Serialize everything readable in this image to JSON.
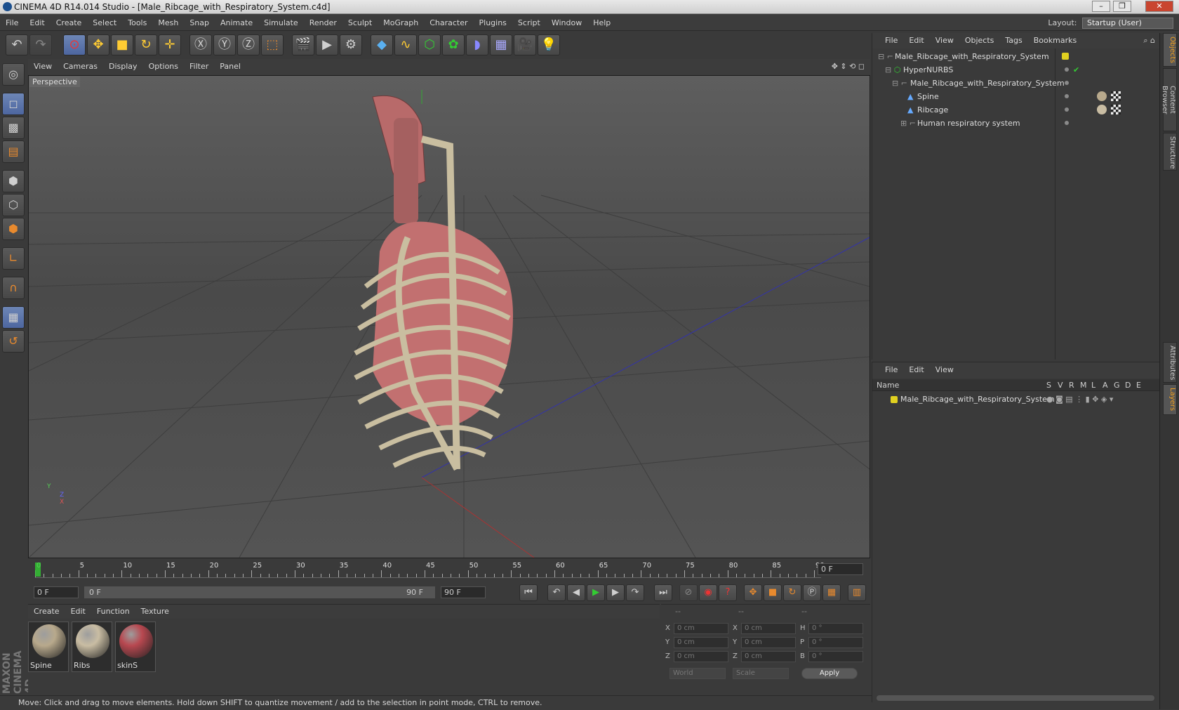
{
  "window": {
    "title": "CINEMA 4D R14.014 Studio - [Male_Ribcage_with_Respiratory_System.c4d]"
  },
  "menu": [
    "File",
    "Edit",
    "Create",
    "Select",
    "Tools",
    "Mesh",
    "Snap",
    "Animate",
    "Simulate",
    "Render",
    "Sculpt",
    "MoGraph",
    "Character",
    "Plugins",
    "Script",
    "Window",
    "Help"
  ],
  "layout": {
    "label": "Layout:",
    "value": "Startup (User)"
  },
  "viewport": {
    "menu": [
      "View",
      "Cameras",
      "Display",
      "Options",
      "Filter",
      "Panel"
    ],
    "label": "Perspective",
    "axis": {
      "x": "X",
      "y": "Y",
      "z": "Z"
    }
  },
  "timeline": {
    "ticks": [
      "0",
      "5",
      "10",
      "15",
      "20",
      "25",
      "30",
      "35",
      "40",
      "45",
      "50",
      "55",
      "60",
      "65",
      "70",
      "75",
      "80",
      "85",
      "90"
    ],
    "current_frame": "0 F",
    "start_field": "0 F",
    "range_start": "0 F",
    "range_end": "90 F",
    "end_field": "90 F"
  },
  "materials": {
    "menu": [
      "Create",
      "Edit",
      "Function",
      "Texture"
    ],
    "items": [
      {
        "name": "Spine",
        "color": "#b8a98c"
      },
      {
        "name": "Ribs",
        "color": "#c9bda3"
      },
      {
        "name": "skinS",
        "color": "#b84850"
      }
    ]
  },
  "coords": {
    "header": [
      "--",
      "--",
      "--"
    ],
    "rows": [
      {
        "a": "X",
        "av": "0 cm",
        "b": "X",
        "bv": "0 cm",
        "c": "H",
        "cv": "0 °"
      },
      {
        "a": "Y",
        "av": "0 cm",
        "b": "Y",
        "bv": "0 cm",
        "c": "P",
        "cv": "0 °"
      },
      {
        "a": "Z",
        "av": "0 cm",
        "b": "Z",
        "bv": "0 cm",
        "c": "B",
        "cv": "0 °"
      }
    ],
    "mode1": "World",
    "mode2": "Scale",
    "apply": "Apply"
  },
  "objects": {
    "menu": [
      "File",
      "Edit",
      "View",
      "Objects",
      "Tags",
      "Bookmarks"
    ],
    "tree": [
      {
        "name": "Male_Ribcage_with_Respiratory_System",
        "level": 0
      },
      {
        "name": "HyperNURBS",
        "level": 1
      },
      {
        "name": "Male_Ribcage_with_Respiratory_System",
        "level": 2
      },
      {
        "name": "Spine",
        "level": 3
      },
      {
        "name": "Ribcage",
        "level": 3
      },
      {
        "name": "Human respiratory system",
        "level": 3
      }
    ]
  },
  "layers": {
    "menu": [
      "File",
      "Edit",
      "View"
    ],
    "header": {
      "name": "Name",
      "cols": [
        "S",
        "V",
        "R",
        "M",
        "L",
        "A",
        "G",
        "D",
        "E"
      ]
    },
    "rows": [
      {
        "name": "Male_Ribcage_with_Respiratory_System",
        "color": "#e0d020"
      }
    ]
  },
  "sidetabs": [
    "Objects",
    "Content Browser",
    "Structure",
    "Attributes",
    "Layers"
  ],
  "status": "Move: Click and drag to move elements. Hold down SHIFT to quantize movement / add to the selection in point mode, CTRL to remove.",
  "brand": "MAXON CINEMA 4D"
}
